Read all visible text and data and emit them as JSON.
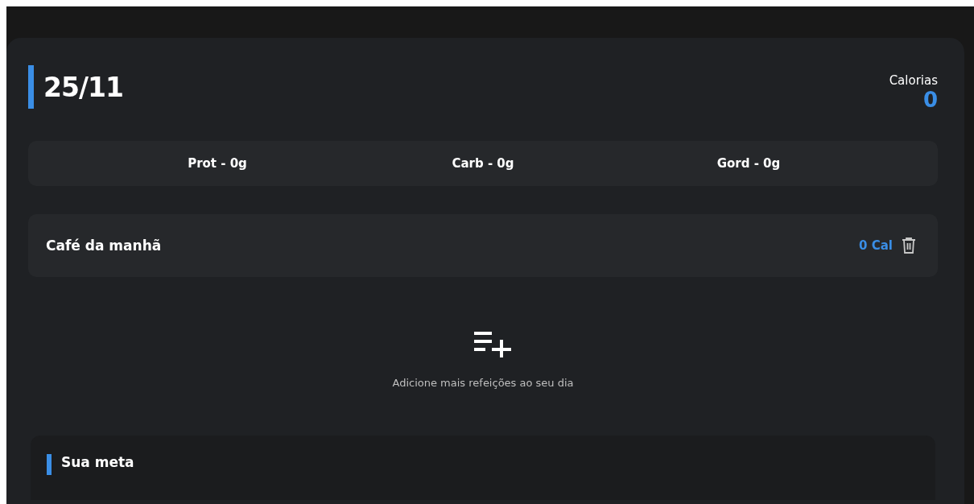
{
  "date": "25/11",
  "calories": {
    "label": "Calorias",
    "value": "0"
  },
  "macros": [
    "Prot - 0g",
    "Carb - 0g",
    "Gord - 0g"
  ],
  "meals": [
    {
      "name": "Café da manhã",
      "calories": "0 Cal"
    }
  ],
  "add_meal": {
    "label": "Adicione mais refeições ao seu dia"
  },
  "goal": {
    "title": "Sua meta"
  }
}
